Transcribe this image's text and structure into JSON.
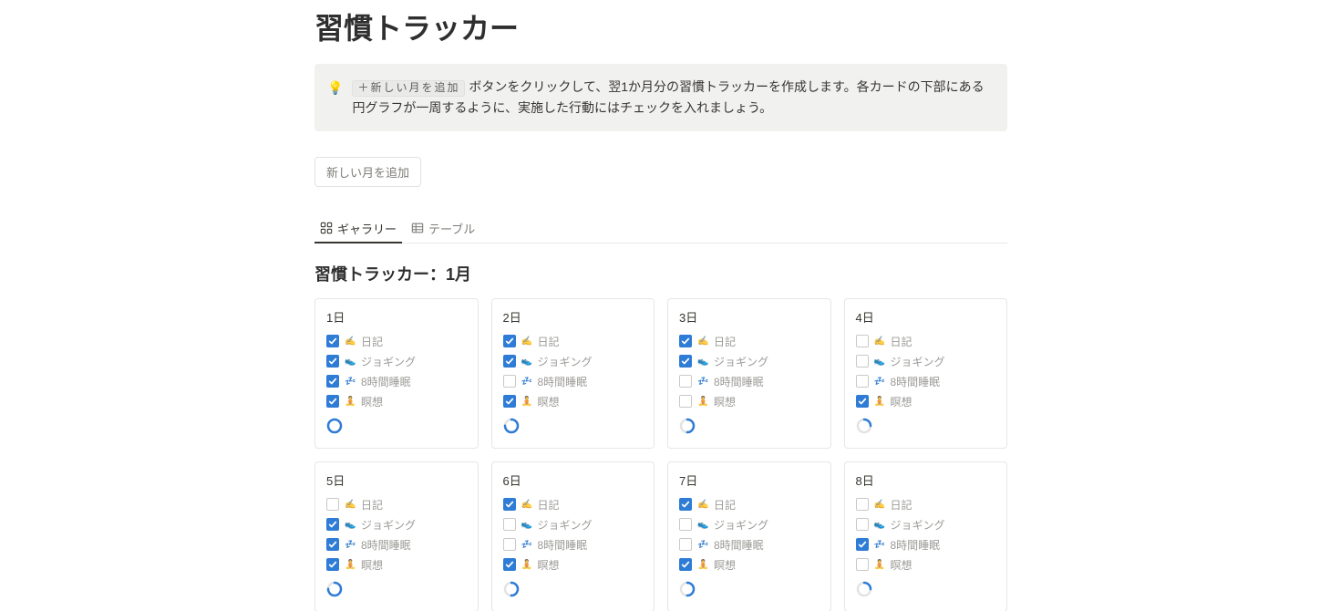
{
  "page_title": "習慣トラッカー",
  "callout": {
    "emoji": "💡",
    "inline_tag": "＋新しい月を追加",
    "text_before": "",
    "text_after": "ボタンをクリックして、翌1か月分の習慣トラッカーを作成します。各カードの下部にある円グラフが一周するように、実施した行動にはチェックを入れましょう。"
  },
  "new_month_button": "新しい月を追加",
  "views": {
    "gallery": "ギャラリー",
    "table": "テーブル"
  },
  "db_title": "習慣トラッカー：1月",
  "habits": [
    {
      "key": "diary",
      "emoji": "✍️",
      "label": "日記"
    },
    {
      "key": "jog",
      "emoji": "👟",
      "label": "ジョギング"
    },
    {
      "key": "sleep",
      "emoji": "💤",
      "label": "8時間睡眠"
    },
    {
      "key": "medit",
      "emoji": "🧘",
      "label": "瞑想"
    }
  ],
  "days": [
    {
      "title": "1日",
      "checks": {
        "diary": true,
        "jog": true,
        "sleep": true,
        "medit": true
      }
    },
    {
      "title": "2日",
      "checks": {
        "diary": true,
        "jog": true,
        "sleep": false,
        "medit": true
      }
    },
    {
      "title": "3日",
      "checks": {
        "diary": true,
        "jog": true,
        "sleep": false,
        "medit": false
      }
    },
    {
      "title": "4日",
      "checks": {
        "diary": false,
        "jog": false,
        "sleep": false,
        "medit": true
      }
    },
    {
      "title": "5日",
      "checks": {
        "diary": false,
        "jog": true,
        "sleep": true,
        "medit": true
      }
    },
    {
      "title": "6日",
      "checks": {
        "diary": true,
        "jog": false,
        "sleep": false,
        "medit": true
      }
    },
    {
      "title": "7日",
      "checks": {
        "diary": true,
        "jog": false,
        "sleep": false,
        "medit": true
      }
    },
    {
      "title": "8日",
      "checks": {
        "diary": false,
        "jog": false,
        "sleep": true,
        "medit": false
      }
    }
  ]
}
